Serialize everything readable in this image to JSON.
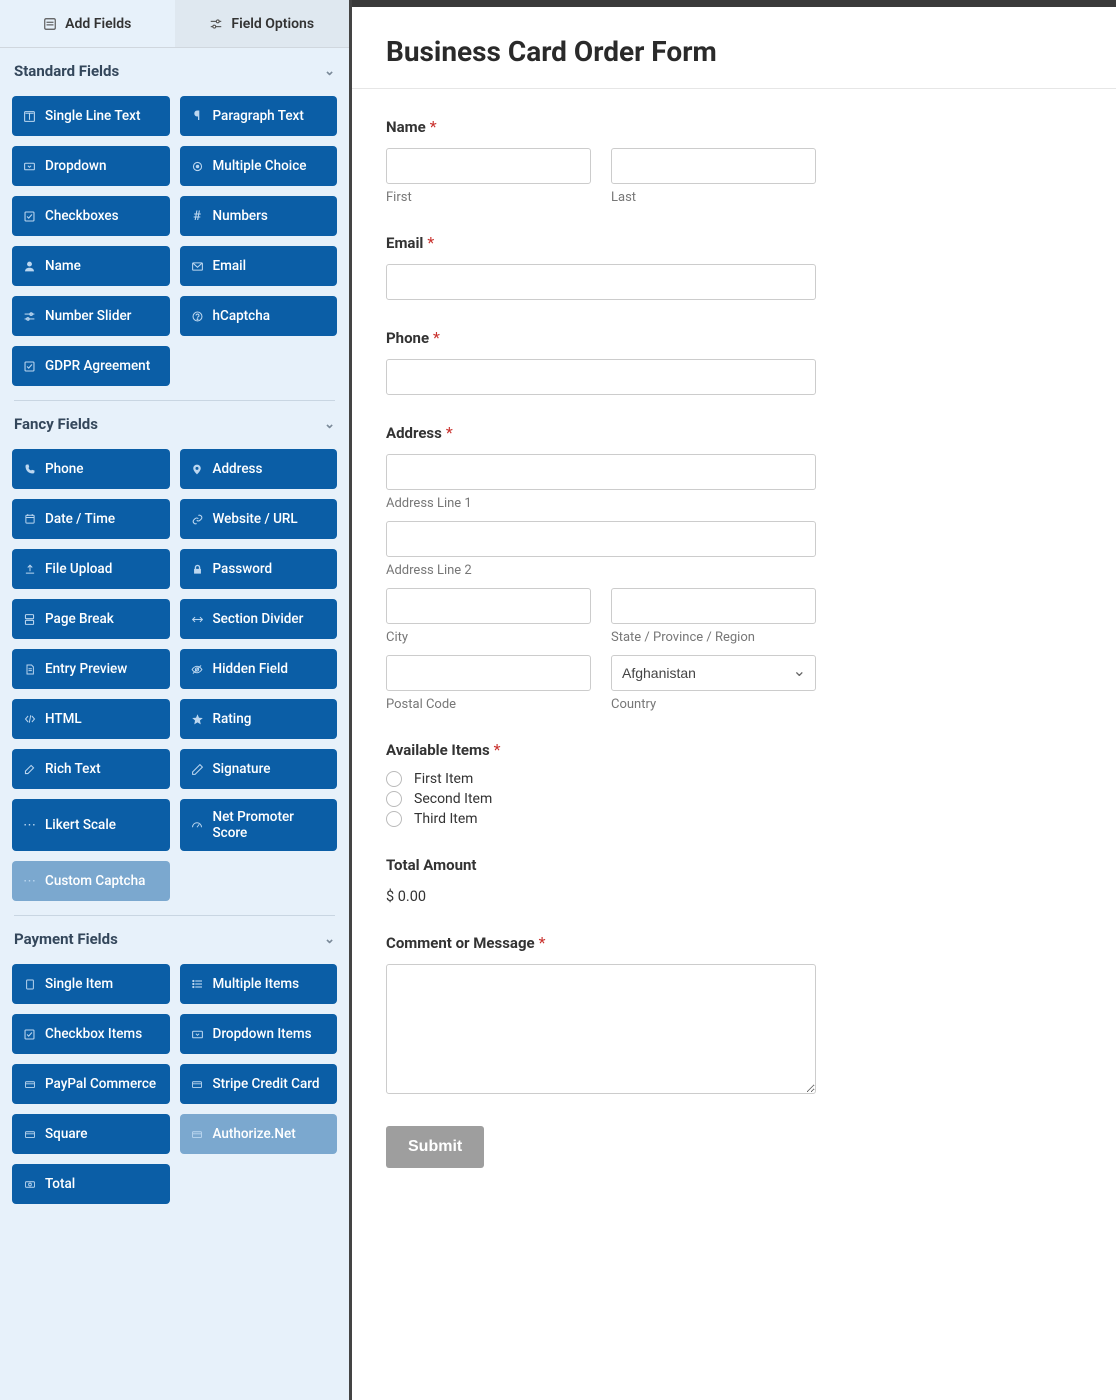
{
  "tabs": {
    "add_fields": "Add Fields",
    "field_options": "Field Options"
  },
  "sections": {
    "standard": {
      "title": "Standard Fields",
      "fields": [
        "Single Line Text",
        "Paragraph Text",
        "Dropdown",
        "Multiple Choice",
        "Checkboxes",
        "Numbers",
        "Name",
        "Email",
        "Number Slider",
        "hCaptcha",
        "GDPR Agreement"
      ]
    },
    "fancy": {
      "title": "Fancy Fields",
      "fields": [
        "Phone",
        "Address",
        "Date / Time",
        "Website / URL",
        "File Upload",
        "Password",
        "Page Break",
        "Section Divider",
        "Entry Preview",
        "Hidden Field",
        "HTML",
        "Rating",
        "Rich Text",
        "Signature",
        "Likert Scale",
        "Net Promoter Score",
        "Custom Captcha"
      ]
    },
    "payment": {
      "title": "Payment Fields",
      "fields": [
        "Single Item",
        "Multiple Items",
        "Checkbox Items",
        "Dropdown Items",
        "PayPal Commerce",
        "Stripe Credit Card",
        "Square",
        "Authorize.Net",
        "Total"
      ]
    }
  },
  "disabled_fields": [
    "Custom Captcha",
    "Authorize.Net"
  ],
  "form": {
    "title": "Business Card Order Form",
    "labels": {
      "name": "Name",
      "first": "First",
      "last": "Last",
      "email": "Email",
      "phone": "Phone",
      "address": "Address",
      "addr1": "Address Line 1",
      "addr2": "Address Line 2",
      "city": "City",
      "state": "State / Province / Region",
      "postal": "Postal Code",
      "country": "Country",
      "items": "Available Items",
      "total": "Total Amount",
      "comment": "Comment or Message",
      "submit": "Submit"
    },
    "items": [
      "First Item",
      "Second Item",
      "Third Item"
    ],
    "country_selected": "Afghanistan",
    "total_value": "$ 0.00"
  }
}
